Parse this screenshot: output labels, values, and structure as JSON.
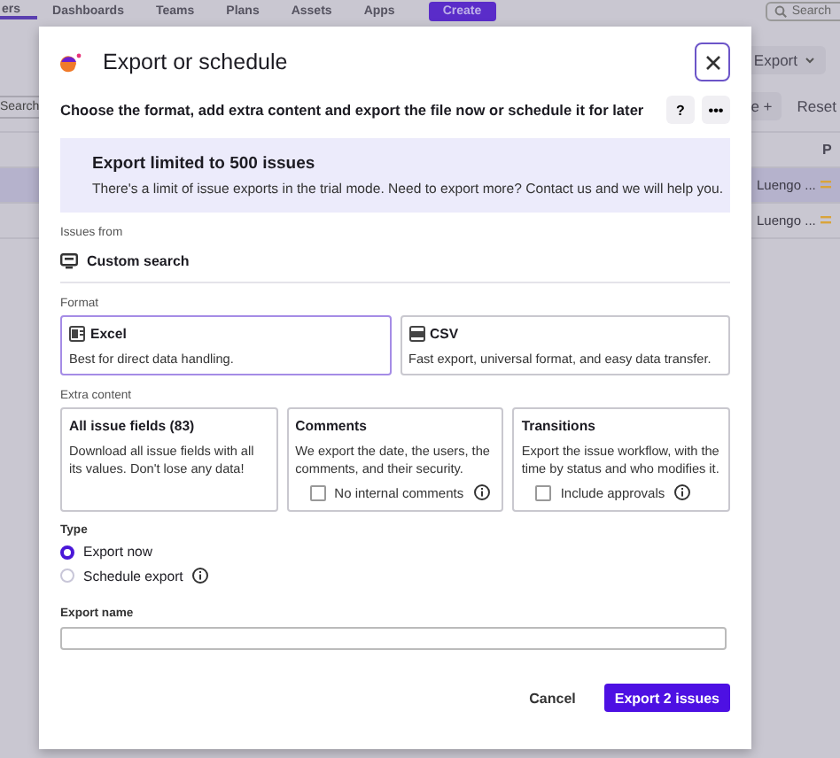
{
  "background": {
    "nav": [
      {
        "label": "ers",
        "selected": true
      },
      {
        "label": "Dashboards",
        "selected": false
      },
      {
        "label": "Teams",
        "selected": false
      },
      {
        "label": "Plans",
        "selected": false
      },
      {
        "label": "Assets",
        "selected": false
      },
      {
        "label": "Apps",
        "selected": false
      }
    ],
    "create_button": "Create",
    "search": {
      "placeholder": "Search"
    },
    "export_button": "Export",
    "filter_search": {
      "placeholder": "Search"
    },
    "more_button": "e +",
    "reset_button": "Reset",
    "column_header": "P",
    "rows": [
      {
        "assignee": "Luengo ...",
        "selected": true
      },
      {
        "assignee": "Luengo ...",
        "selected": false
      }
    ]
  },
  "dialog": {
    "title": "Export or schedule",
    "subtitle": "Choose the format, add extra content and export the file now or schedule it for later",
    "help_button": "?",
    "more_button": "•••",
    "banner": {
      "title": "Export limited to 500 issues",
      "text": "There's a limit of issue exports in the trial mode. Need to export more? Contact us and we will help you."
    },
    "issues_from": {
      "label": "Issues from",
      "value": "Custom search"
    },
    "format": {
      "label": "Format",
      "options": [
        {
          "kind": "excel",
          "title": "Excel",
          "description": "Best for direct data handling.",
          "selected": true
        },
        {
          "kind": "csv",
          "title": "CSV",
          "description": "Fast export, universal format, and easy data transfer.",
          "selected": false
        }
      ]
    },
    "extra_content": {
      "label": "Extra content",
      "cards": [
        {
          "title": "All issue fields (83)",
          "description": "Download all issue fields with all its values. Don't lose any data!"
        },
        {
          "title": "Comments",
          "description": "We export the date, the users, the comments, and their security.",
          "checkbox": {
            "label": "No internal comments",
            "checked": false
          }
        },
        {
          "title": "Transitions",
          "description": "Export the issue workflow, with the time by status and who modifies it.",
          "checkbox": {
            "label": "Include approvals",
            "checked": false
          }
        }
      ]
    },
    "type": {
      "label": "Type",
      "options": [
        {
          "label": "Export now",
          "selected": true,
          "info": false
        },
        {
          "label": "Schedule export",
          "selected": false,
          "info": true
        }
      ]
    },
    "export_name": {
      "label": "Export name"
    },
    "buttons": {
      "cancel": "Cancel",
      "primary": "Export 2 issues"
    }
  }
}
